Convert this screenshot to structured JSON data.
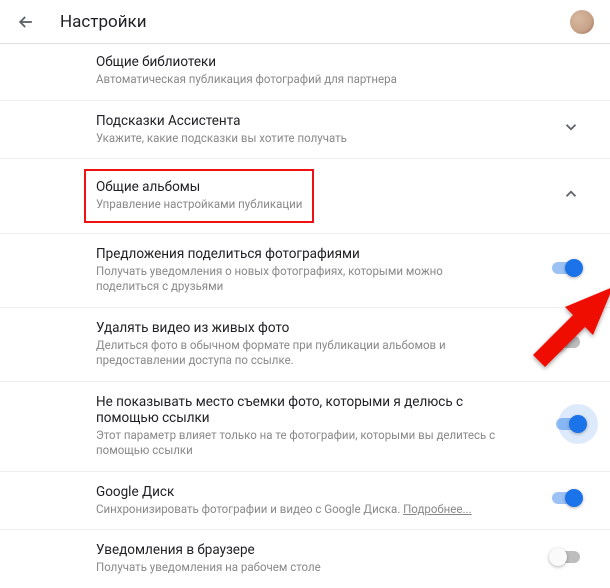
{
  "header": {
    "title": "Настройки"
  },
  "sections": {
    "sharedLibraries": {
      "title": "Общие библиотеки",
      "sub": "Автоматическая публикация фотографий для партнера"
    },
    "assistantHints": {
      "title": "Подсказки Ассистента",
      "sub": "Укажите, какие подсказки вы хотите получать"
    },
    "sharedAlbums": {
      "title": "Общие альбомы",
      "sub": "Управление настройками публикации"
    },
    "shareSuggestions": {
      "title": "Предложения поделиться фотографиями",
      "sub": "Получать уведомления о новых фотографиях, которыми можно поделиться с друзьями",
      "on": true
    },
    "removeVideoFromLive": {
      "title": "Удалять видео из живых фото",
      "sub": "Делиться фото в обычном формате при публикации альбомов и предоставлении доступа по ссылке.",
      "on": false
    },
    "hideLocation": {
      "title": "Не показывать место съемки фото, которыми я делюсь с помощью ссылки",
      "sub": "Этот параметр влияет только на те фотографии, которыми вы делитесь с помощью ссылки",
      "on": true
    },
    "googleDrive": {
      "title": "Google Диск",
      "subPrefix": "Синхронизировать фотографии и видео с Google Диска. ",
      "learnMore": "Подробнее...",
      "on": true
    },
    "browserNotifications": {
      "title": "Уведомления в браузере",
      "sub": "Получать уведомления на рабочем столе",
      "on": false
    }
  }
}
